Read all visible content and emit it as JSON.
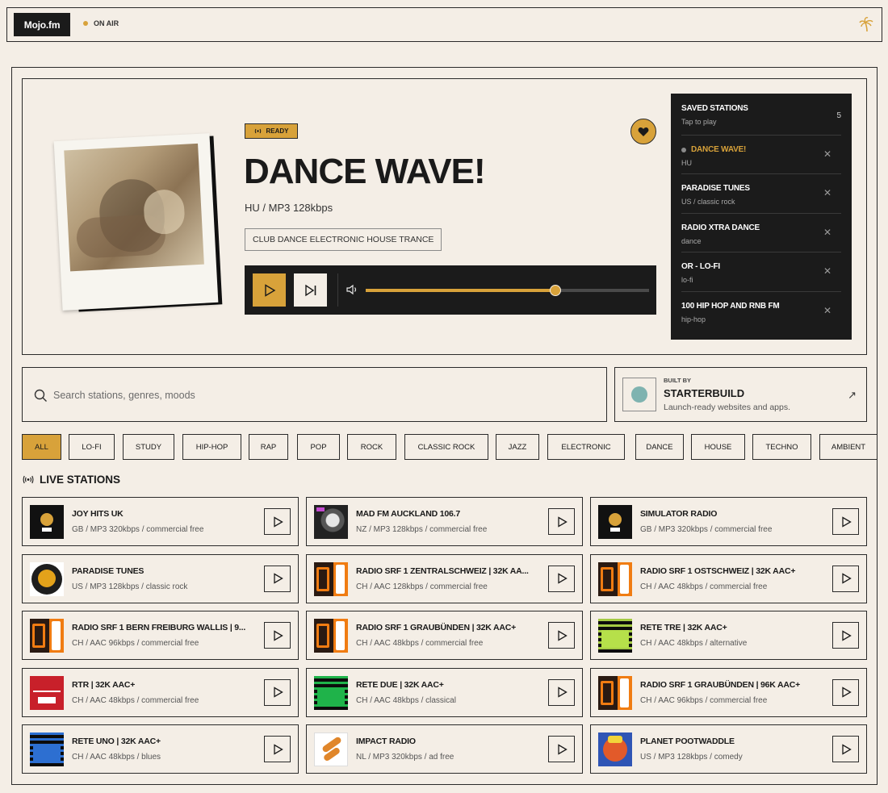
{
  "topbar": {
    "logo": "Mojo.fm",
    "status": "ON AIR",
    "right_icon": "palm-tree-icon"
  },
  "now_playing": {
    "badge": "READY",
    "title": "DANCE WAVE!",
    "meta": "HU / MP3 128kbps",
    "tags": "CLUB DANCE ELECTRONIC HOUSE TRANCE",
    "volume_percent": 67
  },
  "saved": {
    "title": "SAVED STATIONS",
    "subtitle": "Tap to play",
    "count": "5",
    "items": [
      {
        "name": "DANCE WAVE!",
        "sub": "HU",
        "active": true
      },
      {
        "name": "PARADISE TUNES",
        "sub": "US / classic rock",
        "active": false
      },
      {
        "name": "RADIO XTRA DANCE",
        "sub": "dance",
        "active": false
      },
      {
        "name": "OR - LO-FI",
        "sub": "lo-fi",
        "active": false
      },
      {
        "name": "100 HIP HOP AND RNB FM",
        "sub": "hip-hop",
        "active": false
      }
    ]
  },
  "search": {
    "placeholder": "Search stations, genres, moods"
  },
  "builder": {
    "by": "BUILT BY",
    "name": "STARTERBUILD",
    "desc": "Launch-ready websites and apps.",
    "arrow": "↗"
  },
  "genres": [
    "ALL",
    "LO-FI",
    "STUDY",
    "HIP-HOP",
    "RAP",
    "POP",
    "ROCK",
    "CLASSIC ROCK",
    "JAZZ",
    "ELECTRONIC",
    "DANCE",
    "HOUSE",
    "TECHNO",
    "AMBIENT"
  ],
  "active_genre": "ALL",
  "live": {
    "heading": "LIVE STATIONS",
    "stations": [
      {
        "title": "JOY HITS UK",
        "meta": "GB / MP3 320kbps / commercial free",
        "art": "joy"
      },
      {
        "title": "MAD FM AUCKLAND 106.7",
        "meta": "NZ / MP3 128kbps / commercial free",
        "art": "mad"
      },
      {
        "title": "SIMULATOR RADIO",
        "meta": "GB / MP3 320kbps / commercial free",
        "art": "joy"
      },
      {
        "title": "PARADISE TUNES",
        "meta": "US / MP3 128kbps / classic rock",
        "art": "paradise"
      },
      {
        "title": "RADIO SRF 1 ZENTRALSCHWEIZ | 32K AA...",
        "meta": "CH / AAC 128kbps / commercial free",
        "art": "srf"
      },
      {
        "title": "RADIO SRF 1 OSTSCHWEIZ | 32K AAC+",
        "meta": "CH / AAC 48kbps / commercial free",
        "art": "srf"
      },
      {
        "title": "RADIO SRF 1 BERN FREIBURG WALLIS | 9...",
        "meta": "CH / AAC 96kbps / commercial free",
        "art": "srf"
      },
      {
        "title": "RADIO SRF 1 GRAUBÜNDEN | 32K AAC+",
        "meta": "CH / AAC 48kbps / commercial free",
        "art": "srf"
      },
      {
        "title": "RETE TRE | 32K AAC+",
        "meta": "CH / AAC 48kbps / alternative",
        "art": "tre"
      },
      {
        "title": "RTR | 32K AAC+",
        "meta": "CH / AAC 48kbps / commercial free",
        "art": "rtr"
      },
      {
        "title": "RETE DUE | 32K AAC+",
        "meta": "CH / AAC 48kbps / classical",
        "art": "due"
      },
      {
        "title": "RADIO SRF 1 GRAUBÜNDEN | 96K AAC+",
        "meta": "CH / AAC 96kbps / commercial free",
        "art": "srf"
      },
      {
        "title": "RETE UNO | 32K AAC+",
        "meta": "CH / AAC 48kbps / blues",
        "art": "uno"
      },
      {
        "title": "IMPACT RADIO",
        "meta": "NL / MP3 320kbps / ad free",
        "art": "impact"
      },
      {
        "title": "PLANET POOTWADDLE",
        "meta": "US / MP3 128kbps / comedy",
        "art": "planet"
      }
    ]
  },
  "colors": {
    "accent": "#d8a23a",
    "background": "#f4eee6",
    "dark": "#1b1b1b"
  }
}
